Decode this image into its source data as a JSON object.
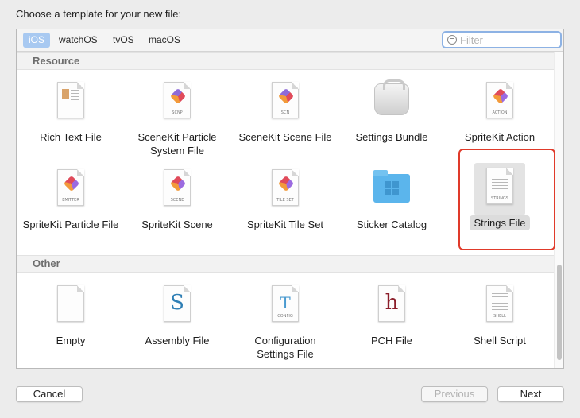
{
  "dialog": {
    "prompt": "Choose a template for your new file:"
  },
  "tabs": [
    {
      "label": "iOS",
      "active": true
    },
    {
      "label": "watchOS",
      "active": false
    },
    {
      "label": "tvOS",
      "active": false
    },
    {
      "label": "macOS",
      "active": false
    }
  ],
  "filter": {
    "placeholder": "Filter",
    "value": ""
  },
  "sections": {
    "resource": {
      "title": "Resource",
      "items": [
        {
          "label": "Rich Text File",
          "icon": "rtf-document-icon"
        },
        {
          "label": "SceneKit Particle System File",
          "icon": "scnp-document-icon",
          "tag": "SCNP"
        },
        {
          "label": "SceneKit Scene File",
          "icon": "scn-document-icon",
          "tag": "SCN"
        },
        {
          "label": "Settings Bundle",
          "icon": "settings-bundle-icon"
        },
        {
          "label": "SpriteKit Action",
          "icon": "spritekit-action-icon",
          "tag": "ACTION"
        },
        {
          "label": "SpriteKit Particle File",
          "icon": "emitter-document-icon",
          "tag": "EMITTER"
        },
        {
          "label": "SpriteKit Scene",
          "icon": "sks-document-icon",
          "tag": "SCENE"
        },
        {
          "label": "SpriteKit Tile Set",
          "icon": "tileset-document-icon",
          "tag": "TILE SET"
        },
        {
          "label": "Sticker Catalog",
          "icon": "sticker-folder-icon"
        },
        {
          "label": "Strings File",
          "icon": "strings-document-icon",
          "tag": "STRINGS",
          "selected": true
        }
      ]
    },
    "other": {
      "title": "Other",
      "items": [
        {
          "label": "Empty",
          "icon": "empty-document-icon"
        },
        {
          "label": "Assembly File",
          "icon": "assembly-document-icon",
          "glyph": "S"
        },
        {
          "label": "Configuration Settings File",
          "icon": "config-document-icon",
          "tag": "CONFIG"
        },
        {
          "label": "PCH File",
          "icon": "pch-document-icon",
          "glyph": "h"
        },
        {
          "label": "Shell Script",
          "icon": "shell-document-icon",
          "tag": "SHELL"
        }
      ]
    }
  },
  "buttons": {
    "cancel": "Cancel",
    "previous": "Previous",
    "next": "Next"
  },
  "colors": {
    "accent_selected_tab": "#a8c9f1",
    "highlight_box": "#e03a2a",
    "assembly_glyph": "#2f7fb5",
    "pch_glyph": "#8b1e2a"
  }
}
